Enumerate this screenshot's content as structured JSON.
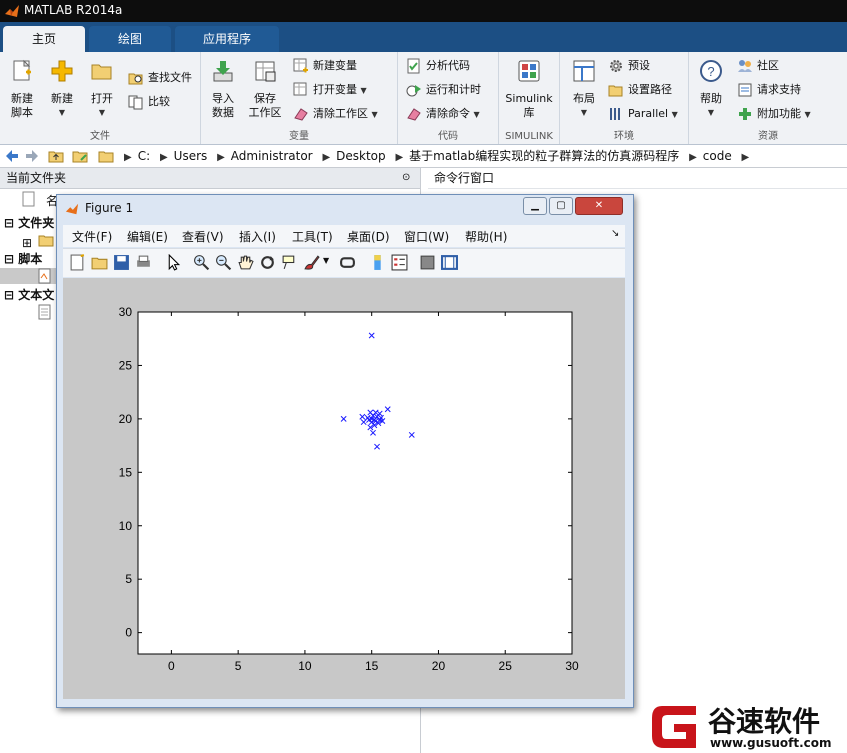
{
  "app": {
    "title": "MATLAB R2014a"
  },
  "tabs": [
    {
      "label": "主页",
      "active": true
    },
    {
      "label": "绘图",
      "active": false
    },
    {
      "label": "应用程序",
      "active": false
    }
  ],
  "ribbon": {
    "file_group": {
      "label": "文件",
      "new_script": "新建\n脚本",
      "new": "新建",
      "open": "打开",
      "find_files": "查找文件",
      "compare": "比较"
    },
    "variable_group": {
      "label": "变量",
      "import": "导入\n数据",
      "save_ws": "保存\n工作区",
      "new_var": "新建变量",
      "open_var": "打开变量",
      "clear_ws": "清除工作区"
    },
    "code_group": {
      "label": "代码",
      "analyze": "分析代码",
      "run_time": "运行和计时",
      "clear_cmd": "清除命令"
    },
    "simulink_group": {
      "label": "SIMULINK",
      "simulink": "Simulink\n库"
    },
    "env_group": {
      "label": "环境",
      "layout": "布局",
      "prefs": "预设",
      "set_path": "设置路径",
      "parallel": "Parallel"
    },
    "resources_group": {
      "label": "资源",
      "help": "帮助",
      "community": "社区",
      "support": "请求支持",
      "addons": "附加功能"
    }
  },
  "address": {
    "crumbs": [
      "C:",
      "Users",
      "Administrator",
      "Desktop",
      "基于matlab编程实现的粒子群算法的仿真源码程序",
      "code"
    ]
  },
  "left_panel": {
    "title": "当前文件夹",
    "col_name": "名",
    "tree": [
      "文件夹",
      "脚本",
      "文本文"
    ]
  },
  "command_window": {
    "title": "命令行窗口"
  },
  "figure": {
    "title": "Figure 1",
    "menus": [
      "文件(F)",
      "编辑(E)",
      "查看(V)",
      "插入(I)",
      "工具(T)",
      "桌面(D)",
      "窗口(W)",
      "帮助(H)"
    ],
    "toolbar_icons": [
      "new-figure-icon",
      "open-icon",
      "save-icon",
      "print-icon",
      "pointer-icon",
      "zoom-in-icon",
      "zoom-out-icon",
      "pan-icon",
      "rotate-icon",
      "data-cursor-icon",
      "brush-icon",
      "link-icon",
      "colorbar-icon",
      "legend-icon",
      "hide-plot-tools-icon",
      "show-plot-tools-icon"
    ]
  },
  "watermark": {
    "brand": "谷速软件",
    "url": "www.gusuoft.com"
  },
  "chart_data": {
    "type": "scatter",
    "marker": "x",
    "color": "#1a1aff",
    "xlim": [
      -2.5,
      30
    ],
    "ylim": [
      -2,
      30
    ],
    "xticks": [
      0,
      5,
      10,
      15,
      20,
      25,
      30
    ],
    "yticks": [
      0,
      5,
      10,
      15,
      20,
      25,
      30
    ],
    "points": [
      [
        15.0,
        27.8
      ],
      [
        12.9,
        20.0
      ],
      [
        14.3,
        20.2
      ],
      [
        14.4,
        19.7
      ],
      [
        16.2,
        20.9
      ],
      [
        18.0,
        18.5
      ],
      [
        15.4,
        17.4
      ],
      [
        15.1,
        18.7
      ],
      [
        14.9,
        19.2
      ],
      [
        15.6,
        20.5
      ],
      [
        15.2,
        19.9
      ],
      [
        15.0,
        20.0
      ],
      [
        15.3,
        19.8
      ],
      [
        15.1,
        20.3
      ],
      [
        14.8,
        19.9
      ],
      [
        15.5,
        19.6
      ],
      [
        15.7,
        20.1
      ],
      [
        14.9,
        20.6
      ],
      [
        15.4,
        20.2
      ],
      [
        15.2,
        19.4
      ],
      [
        15.8,
        19.8
      ],
      [
        15.0,
        19.7
      ],
      [
        15.6,
        19.9
      ],
      [
        14.7,
        20.1
      ],
      [
        15.3,
        20.6
      ]
    ]
  }
}
